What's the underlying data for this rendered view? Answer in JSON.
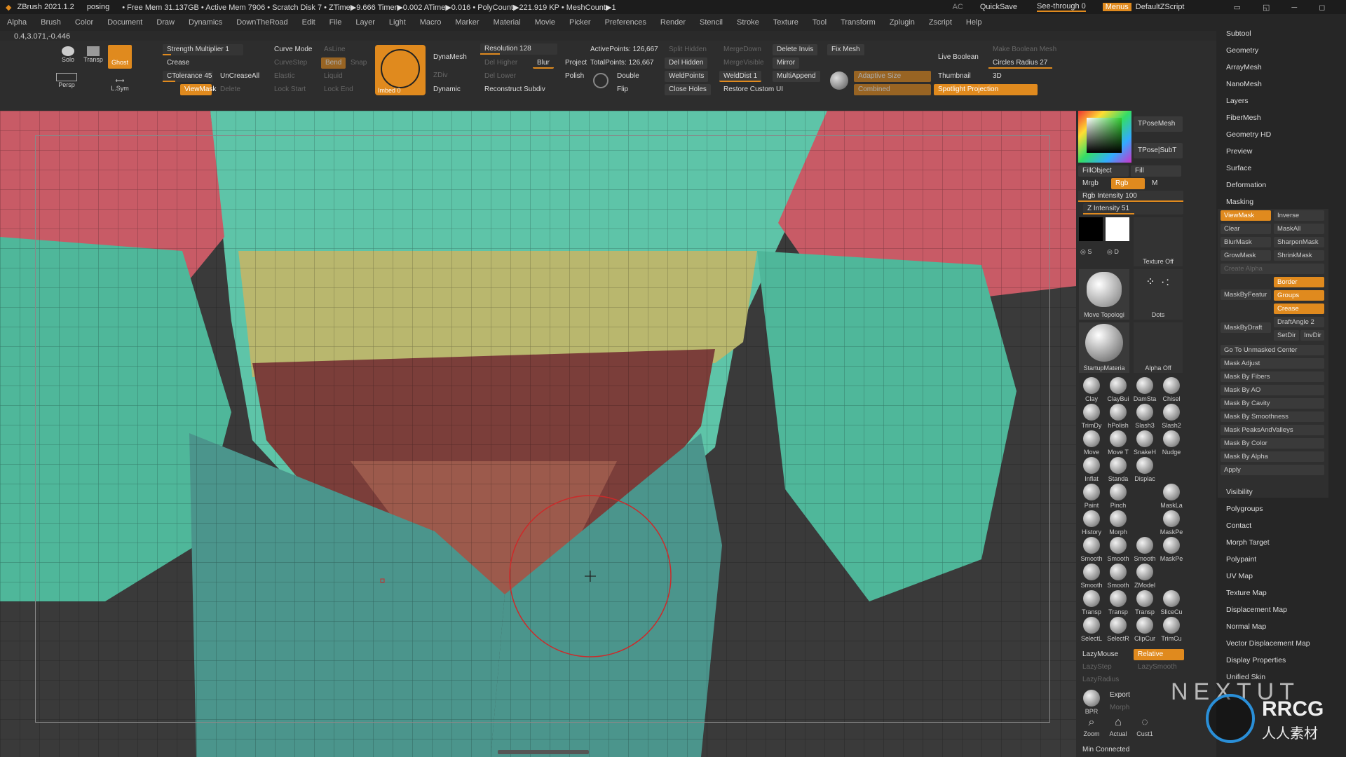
{
  "titlebar": {
    "app": "ZBrush 2021.1.2",
    "doc": "posing",
    "stats": "• Free Mem 31.137GB • Active Mem 7906 • Scratch Disk 7 • ZTime▶9.666 Timer▶0.002 ATime▶0.016 • PolyCount▶221.919 KP • MeshCount▶1",
    "ac": "AC",
    "quicksave": "QuickSave",
    "seethrough": "See-through  0",
    "menus": "Menus",
    "script": "DefaultZScript"
  },
  "menubar": {
    "items": [
      "Alpha",
      "Brush",
      "Color",
      "Document",
      "Draw",
      "Dynamics",
      "DownTheRoad",
      "Edit",
      "File",
      "Layer",
      "Light",
      "Macro",
      "Marker",
      "Material",
      "Movie",
      "Picker",
      "Preferences",
      "Render",
      "Stencil",
      "Stroke",
      "Texture",
      "Tool",
      "Transform",
      "Zplugin",
      "Zscript",
      "Help"
    ]
  },
  "coords": "0.4,3.071,-0.446",
  "shelf": {
    "solo": "Solo",
    "transp": "Transp",
    "ghost": "Ghost",
    "persp": "Persp",
    "lsym": "L.Sym",
    "strength_multiplier": "Strength Multiplier 1",
    "strength_multiplier_level": 0.1,
    "crease": "Crease",
    "ctolerance": "CTolerance 45",
    "ctolerance_level": 0.25,
    "uncreaseall": "UnCreaseAll",
    "viewmask": "ViewMask",
    "delete": "Delete",
    "curve_mode": "Curve Mode",
    "curvestep": "CurveStep",
    "elastic": "Elastic",
    "lock_start": "Lock Start",
    "asline": "AsLine",
    "bend": "Bend",
    "snap": "Snap",
    "liquid": "Liquid",
    "lock_end": "Lock End",
    "imbed": "Imbed 0",
    "dynamesh": "DynaMesh",
    "zdiv": "ZDiv",
    "dynamic": "Dynamic",
    "resolution": "Resolution 128",
    "resolution_level": 0.25,
    "del_higher": "Del Higher",
    "del_lower": "Del Lower",
    "blur": "Blur",
    "project": "Project",
    "polish": "Polish",
    "reconstruct_subdiv": "Reconstruct Subdiv",
    "active_points": "ActivePoints: 126,667",
    "total_points": "TotalPoints: 126,667",
    "split_hidden": "Split Hidden",
    "del_hidden": "Del Hidden",
    "double": "Double",
    "flip": "Flip",
    "weldpoints": "WeldPoints",
    "close_holes": "Close Holes",
    "mergedown": "MergeDown",
    "mergevisible": "MergeVisible",
    "welddist": "WeldDist 1",
    "restore_custom_ui": "Restore Custom UI",
    "delete_invis": "Delete Invis",
    "mirror": "Mirror",
    "multiappend": "MultiAppend",
    "fix_mesh": "Fix Mesh",
    "adaptive_size": "Adaptive Size",
    "combined": "Combined",
    "live_boolean": "Live Boolean",
    "thumbnail": "Thumbnail",
    "make_boolean_mesh": "Make Boolean Mesh",
    "circles_radius": "Circles Radius 27",
    "circles_radius_level": 0.84,
    "three_d": "3D",
    "spotlight_projection": "Spotlight Projection"
  },
  "color_panel": {
    "tposemesh": "TPoseMesh",
    "tpose_subt": "TPose|SubT",
    "fillobject": "FillObject",
    "fill": "Fill",
    "mrgb": "Mrgb",
    "rgb": "Rgb",
    "m": "M",
    "rgb_intensity": "Rgb Intensity 100",
    "rgb_intensity_level": 1.0,
    "z_intensity": "Z Intensity 51",
    "z_intensity_level": 0.51,
    "texture_off": "Texture Off",
    "move_topologic": "Move Topologi",
    "dots": "Dots",
    "startup_material": "StartupMateria",
    "alpha_off": "Alpha Off",
    "s_label": "S",
    "d_label": "D"
  },
  "brushes": [
    [
      "Clay",
      "ClayBui",
      "DamSta",
      "Chisel"
    ],
    [
      "TrimDy",
      "hPolish",
      "Slash3",
      "Slash2"
    ],
    [
      "Move",
      "Move T",
      "SnakeH",
      "Nudge"
    ],
    [
      "Inflat",
      "Standa",
      "Displac",
      ""
    ],
    [
      "Paint",
      "Pinch",
      "",
      "MaskLa"
    ],
    [
      "History",
      "Morph",
      "",
      "MaskPe"
    ],
    [
      "Smooth",
      "Smooth",
      "Smooth",
      "MaskPe"
    ],
    [
      "Smooth",
      "Smooth",
      "ZModel",
      ""
    ],
    [
      "Transp",
      "Transp",
      "Transp",
      "SliceCu"
    ],
    [
      "SelectL",
      "SelectR",
      "ClipCur",
      "TrimCu"
    ]
  ],
  "bottom_tools": {
    "lazymouse": "LazyMouse",
    "relative": "Relative",
    "lazystep": "LazyStep",
    "lazysmooth": "LazySmooth",
    "lazyradius": "LazyRadius",
    "bpr": "BPR",
    "export": "Export",
    "morph": "Morph",
    "zoom": "Zoom",
    "actual": "Actual",
    "cust1": "Cust1",
    "min_connected": "Min Connected"
  },
  "right_menu": {
    "top_items": [
      "Subtool",
      "Geometry",
      "ArrayMesh",
      "NanoMesh",
      "Layers",
      "FiberMesh",
      "Geometry HD",
      "Preview",
      "Surface",
      "Deformation",
      "Masking"
    ],
    "masking": {
      "viewmask": "ViewMask",
      "inverse": "Inverse",
      "clear": "Clear",
      "maskall": "MaskAll",
      "blurmask": "BlurMask",
      "sharpenmask": "SharpenMask",
      "growmask": "GrowMask",
      "shrinkmask": "ShrinkMask",
      "create_alpha": "Create Alpha",
      "maskbyfeature": "MaskByFeatur",
      "border": "Border",
      "groups": "Groups",
      "crease": "Crease",
      "maskbydraft": "MaskByDraft",
      "draftangle": "DraftAngle 2",
      "setdir": "SetDir",
      "invdir": "InvDir",
      "go_to_unmasked": "Go To Unmasked Center",
      "list": [
        "Mask Adjust",
        "Mask By Fibers",
        "Mask By AO",
        "Mask By Cavity",
        "Mask By Smoothness",
        "Mask PeaksAndValleys",
        "Mask By Color",
        "Mask By Alpha",
        "Apply"
      ]
    },
    "bottom_items": [
      "Visibility",
      "Polygroups",
      "Contact",
      "Morph Target",
      "Polypaint",
      "UV Map",
      "Texture Map",
      "Displacement Map",
      "Normal Map",
      "Vector Displacement Map",
      "Display Properties",
      "Unified Skin"
    ]
  },
  "watermark": {
    "nextut": "NEXTUT",
    "rrcg": "RRCG",
    "cn": "人人素材"
  },
  "colors": {
    "accent": "#e08a1e",
    "mesh_teal": "#4fb79a",
    "mesh_red": "#c45a62",
    "mesh_yellow": "#b5b46a",
    "mesh_brown": "#6e3a36"
  }
}
